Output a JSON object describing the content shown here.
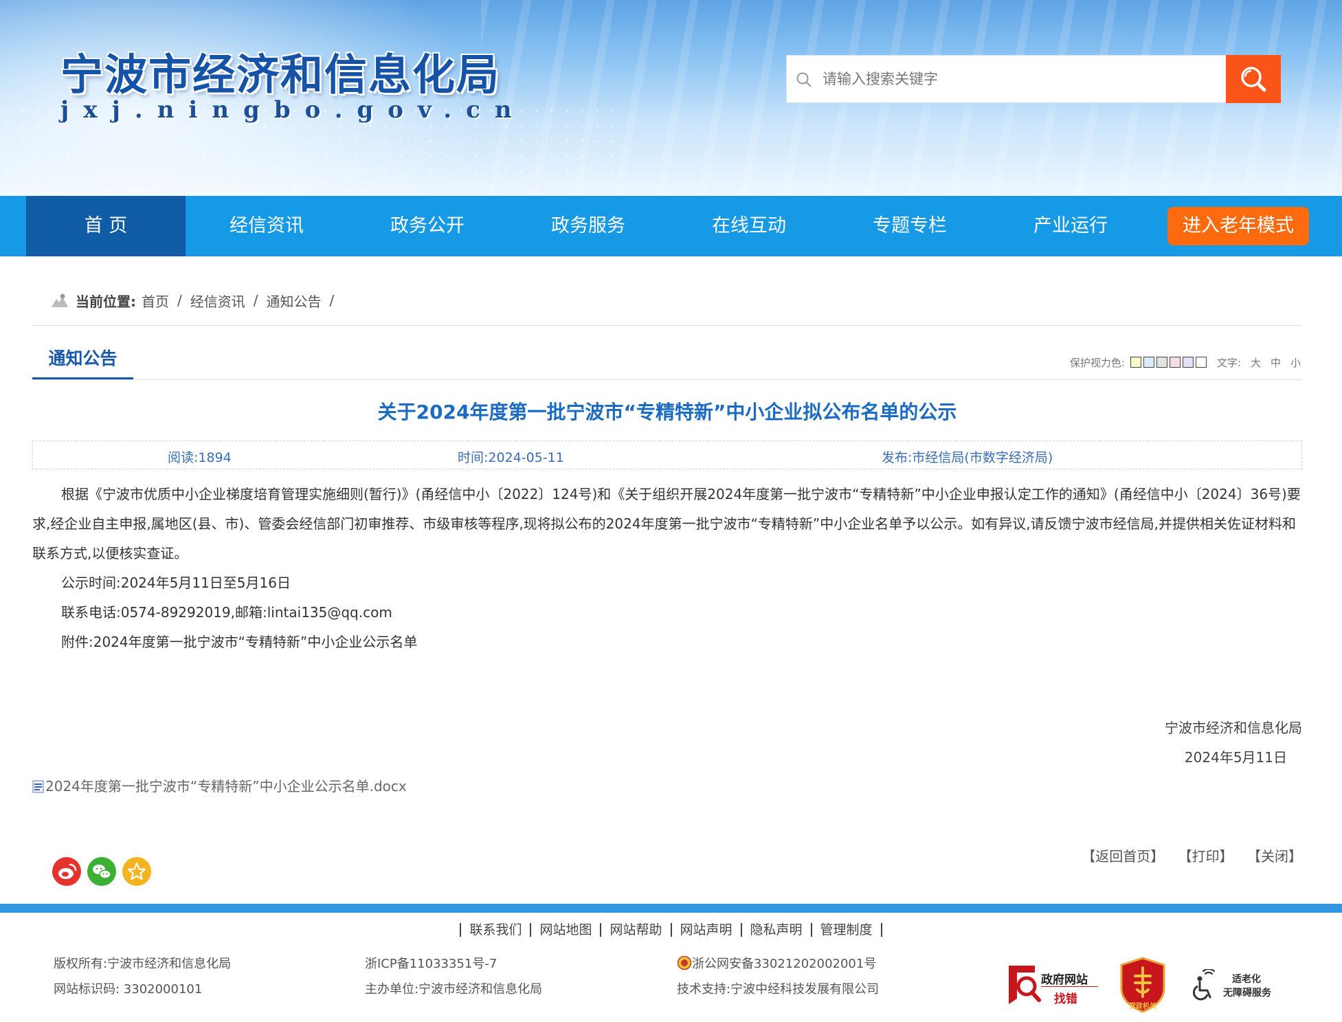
{
  "header": {
    "site_title": "宁波市经济和信息化局",
    "site_domain": "jxj.ningbo.gov.cn",
    "search_placeholder": "请输入搜索关键字"
  },
  "nav": {
    "items": [
      "首 页",
      "经信资讯",
      "政务公开",
      "政务服务",
      "在线互动",
      "专题专栏",
      "产业运行"
    ],
    "active_index": 0,
    "elder_mode": "进入老年模式",
    "colors": {
      "bar": "#179ae6",
      "active": "#105ca7",
      "elder": "#fe6a0e"
    }
  },
  "breadcrumb": {
    "label": "当前位置:",
    "items": [
      "首页",
      "经信资讯",
      "通知公告"
    ]
  },
  "section_title": "通知公告",
  "tools": {
    "eye_label": "保护视力色:",
    "eye_colors": [
      "#fafac9",
      "#dcecf7",
      "#e3e3e3",
      "#f4dde6",
      "#e6def7",
      "#ffffff"
    ],
    "font_label": "文字:",
    "font_sizes": [
      "大",
      "中",
      "小"
    ]
  },
  "article": {
    "title": "关于2024年度第一批宁波市“专精特新”中小企业拟公布名单的公示",
    "reads": "阅读:1894",
    "time": "时间:2024-05-11",
    "publisher": "发布:市经信局(市数字经济局)",
    "paragraphs": [
      "根据《宁波市优质中小企业梯度培育管理实施细则(暂行)》(甬经信中小〔2022〕124号)和《关于组织开展2024年度第一批宁波市“专精特新”中小企业申报认定工作的通知》(甬经信中小〔2024〕36号)要求,经企业自主申报,属地区(县、市)、管委会经信部门初审推荐、市级审核等程序,现将拟公布的2024年度第一批宁波市“专精特新”中小企业名单予以公示。如有异议,请反馈宁波市经信局,并提供相关佐证材料和联系方式,以便核实查证。",
      "公示时间:2024年5月11日至5月16日",
      "联系电话:0574-89292019,邮箱:lintai135@qq.com",
      "附件:2024年度第一批宁波市“专精特新”中小企业公示名单"
    ],
    "signature_org": "宁波市经济和信息化局",
    "signature_date": "2024年5月11日",
    "attachment": "2024年度第一批宁波市“专精特新”中小企业公示名单.docx"
  },
  "actions": [
    "【返回首页】",
    "【打印】",
    "【关闭】"
  ],
  "footer": {
    "links": [
      "联系我们",
      "网站地图",
      "网站帮助",
      "网站声明",
      "隐私声明",
      "管理制度"
    ],
    "copyright": "版权所有:宁波市经济和信息化局",
    "site_code": "网站标识码: 3302000101",
    "icp": "浙ICP备11033351号-7",
    "host": "主办单位:宁波市经济和信息化局",
    "police": "浙公网安备33021202002001号",
    "tech": "技术支持:宁波中经科技发展有限公司",
    "badge_error_1": "政府网站",
    "badge_error_2": "找错",
    "badge_party": "党政机关",
    "badge_access_1": "适老化",
    "badge_access_2": "无障碍服务"
  }
}
